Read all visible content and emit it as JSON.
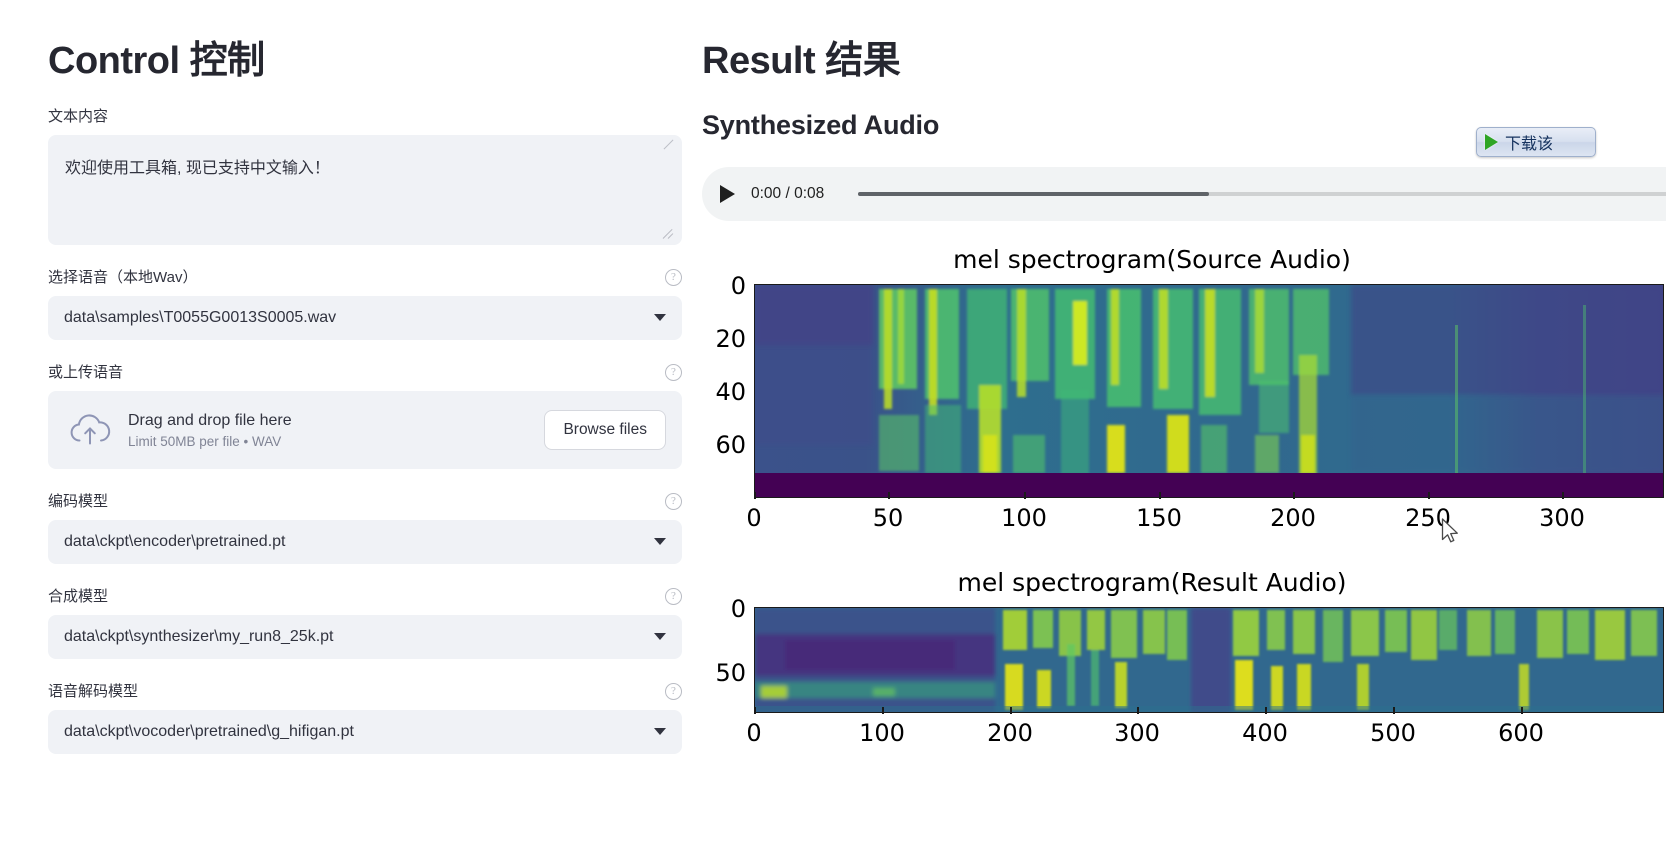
{
  "control": {
    "heading_en": "Control ",
    "heading_cjk": "控制",
    "text_field_label": "文本内容",
    "text_field_value": "欢迎使用工具箱, 现已支持中文输入！",
    "voice_select_label": "选择语音（本地Wav）",
    "voice_select_value": "data\\samples\\T0055G0013S0005.wav",
    "upload_label": "或上传语音",
    "upload_main": "Drag and drop file here",
    "upload_sub": "Limit 50MB per file • WAV",
    "browse_button": "Browse files",
    "encoder_label": "编码模型",
    "encoder_value": "data\\ckpt\\encoder\\pretrained.pt",
    "synthesizer_label": "合成模型",
    "synthesizer_value": "data\\ckpt\\synthesizer\\my_run8_25k.pt",
    "vocoder_label": "语音解码模型",
    "vocoder_value": "data\\ckpt\\vocoder\\pretrained\\g_hifigan.pt",
    "help_icon": "question-mark-circle"
  },
  "result": {
    "heading_en": "Result ",
    "heading_cjk": "结果",
    "audio_section_title": "Synthesized Audio",
    "player": {
      "play_icon": "play-triangle",
      "time_display": "0:00 / 0:08",
      "current_time": "0:00",
      "duration": "0:08",
      "progress_percent": 42
    },
    "download_button": {
      "label": "下载该",
      "icon": "green-play-triangle"
    }
  },
  "chart_data": [
    {
      "type": "heatmap",
      "title": "mel spectrogram(Source Audio)",
      "xlabel": "",
      "ylabel": "",
      "xticks": [
        0,
        50,
        100,
        150,
        200,
        250,
        300
      ],
      "yticks": [
        0,
        20,
        40,
        60
      ],
      "xlim": [
        0,
        310
      ],
      "ylim": [
        80,
        0
      ],
      "colormap": "viridis",
      "grid": false,
      "legend": "none",
      "note": "Mel spectrogram of source reference audio; bright harmonic bands between frames 40-230, silent purple band at bottom (mel bins ~72-80)."
    },
    {
      "type": "heatmap",
      "title": "mel spectrogram(Result Audio)",
      "xlabel": "",
      "ylabel": "",
      "xticks": [
        0,
        100,
        200,
        300,
        400,
        500,
        600
      ],
      "yticks": [
        0,
        50
      ],
      "xlim": [
        0,
        640
      ],
      "ylim": [
        80,
        0
      ],
      "colormap": "viridis",
      "grid": false,
      "legend": "none",
      "note": "Mel spectrogram of synthesized result audio; dark low-energy leading segment up to frame ~170, then voiced harmonic stacks."
    }
  ],
  "colors": {
    "widget_bg": "#f0f2f6",
    "text": "#31333f",
    "heading": "#262730",
    "muted": "#808495",
    "player_bg": "#f1f3f4",
    "download_accent": "#2fa524"
  }
}
